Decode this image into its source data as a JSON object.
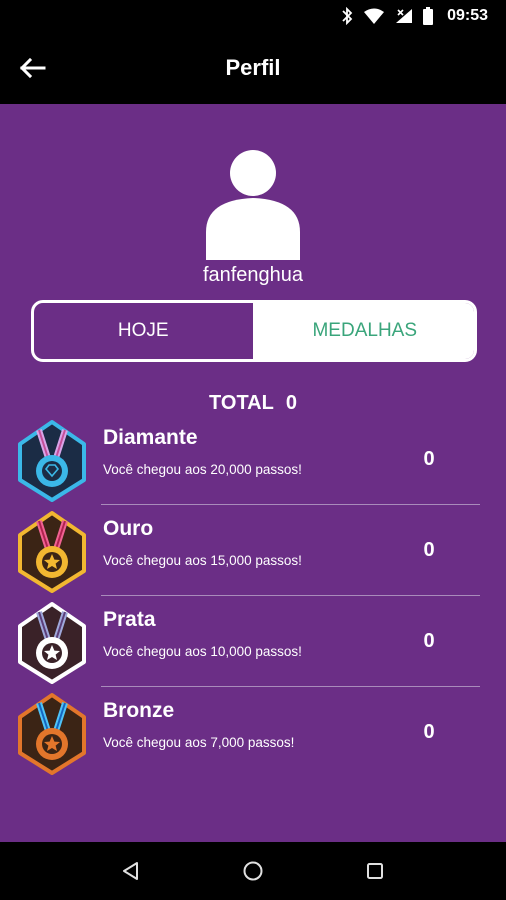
{
  "status_bar": {
    "time": "09:53",
    "icons": [
      "bluetooth-icon",
      "wifi-icon",
      "signal-icon",
      "battery-icon"
    ]
  },
  "app_bar": {
    "title": "Perfil",
    "back_icon": "arrow-left-icon"
  },
  "profile": {
    "avatar_icon": "person-icon",
    "username": "fanfenghua"
  },
  "tabs": {
    "hoje": "HOJE",
    "medalhas": "MEDALHAS",
    "selected": "MEDALHAS"
  },
  "total": {
    "label": "TOTAL",
    "value": "0"
  },
  "medals": [
    {
      "name": "Diamante",
      "description": "Você chegou aos 20,000 passos!",
      "count": "0",
      "icon": "diamond-medal-icon",
      "color": "#3bb8e8"
    },
    {
      "name": "Ouro",
      "description": "Você chegou aos 15,000 passos!",
      "count": "0",
      "icon": "gold-medal-icon",
      "color": "#f2b731"
    },
    {
      "name": "Prata",
      "description": "Você chegou aos 10,000 passos!",
      "count": "0",
      "icon": "silver-medal-icon",
      "color": "#ffffff"
    },
    {
      "name": "Bronze",
      "description": "Você chegou aos 7,000 passos!",
      "count": "0",
      "icon": "bronze-medal-icon",
      "color": "#e3762b"
    }
  ],
  "nav_bar": {
    "buttons": [
      "back-triangle-icon",
      "home-circle-icon",
      "recents-square-icon"
    ]
  },
  "colors": {
    "background": "#6b2e86",
    "tab_selected_text": "#3aa57b"
  }
}
